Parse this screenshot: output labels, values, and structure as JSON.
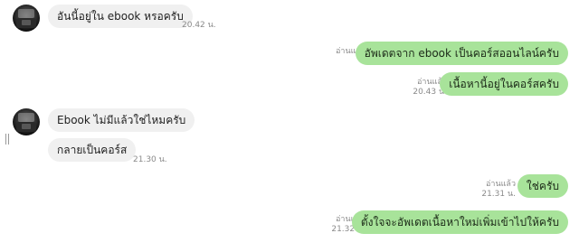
{
  "messages": [
    {
      "side": "in",
      "text": "อันนี้อยู่ใน ebook หรอครับ",
      "time": "20.42 น."
    },
    {
      "side": "out",
      "text": "อัพเดตจาก ebook เป็นคอร์สออนไลน์ครับ",
      "read": "อ่านแล้ว"
    },
    {
      "side": "out",
      "text": "เนื้อหานี้อยู่ในคอร์สครับ",
      "read": "อ่านแล้ว",
      "time": "20.43 น."
    },
    {
      "side": "in",
      "text": "Ebook ไม่มีแล้วใช่ไหมครับ"
    },
    {
      "side": "in",
      "text": "กลายเป็นคอร์ส",
      "time": "21.30 น."
    },
    {
      "side": "out",
      "text": "ใช่ครับ",
      "read": "อ่านแล้ว",
      "time": "21.31 น."
    },
    {
      "side": "out",
      "text": "ตั้งใจจะอัพเดตเนื้อหาใหม่เพิ่มเข้าไปให้ครับ",
      "read": "อ่านแล้ว",
      "time": "21.32 น."
    }
  ]
}
